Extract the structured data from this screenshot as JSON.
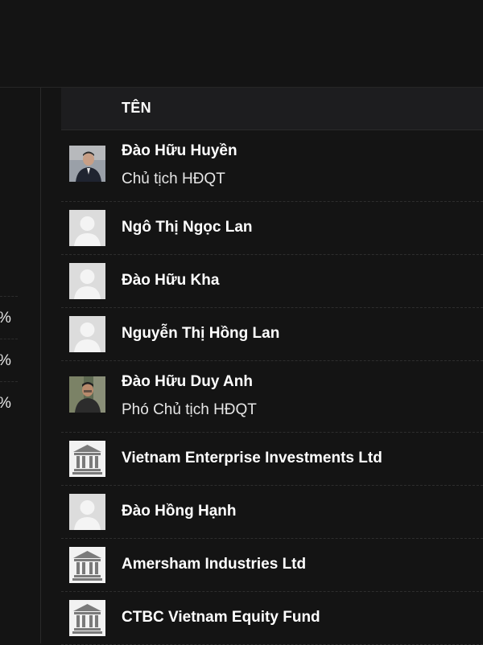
{
  "table": {
    "header": {
      "name_col": "TÊN"
    },
    "rows": [
      {
        "name": "Đào Hữu Huyền",
        "role": "Chủ tịch HĐQT",
        "avatar": "person-photo"
      },
      {
        "name": "Ngô Thị Ngọc Lan",
        "avatar": "person-placeholder"
      },
      {
        "name": "Đào Hữu Kha",
        "avatar": "person-placeholder"
      },
      {
        "name": "Nguyễn Thị Hồng Lan",
        "avatar": "person-placeholder"
      },
      {
        "name": "Đào Hữu Duy Anh",
        "role": "Phó Chủ tịch HĐQT",
        "avatar": "person-photo"
      },
      {
        "name": "Vietnam Enterprise Investments Ltd",
        "avatar": "institution-icon"
      },
      {
        "name": "Đào Hồng Hạnh",
        "avatar": "person-placeholder"
      },
      {
        "name": "Amersham Industries Ltd",
        "avatar": "institution-icon"
      },
      {
        "name": "CTBC Vietnam Equity Fund",
        "avatar": "institution-icon"
      }
    ]
  },
  "left_panel": {
    "percent_suffixes": [
      "%",
      "%",
      "%"
    ]
  },
  "colors": {
    "background": "#141414",
    "header_bg": "#1d1d1f",
    "placeholder": "#dcdcdc",
    "placeholder_figure": "#f2f2f2",
    "institution_icon": "#7a7a7a"
  }
}
